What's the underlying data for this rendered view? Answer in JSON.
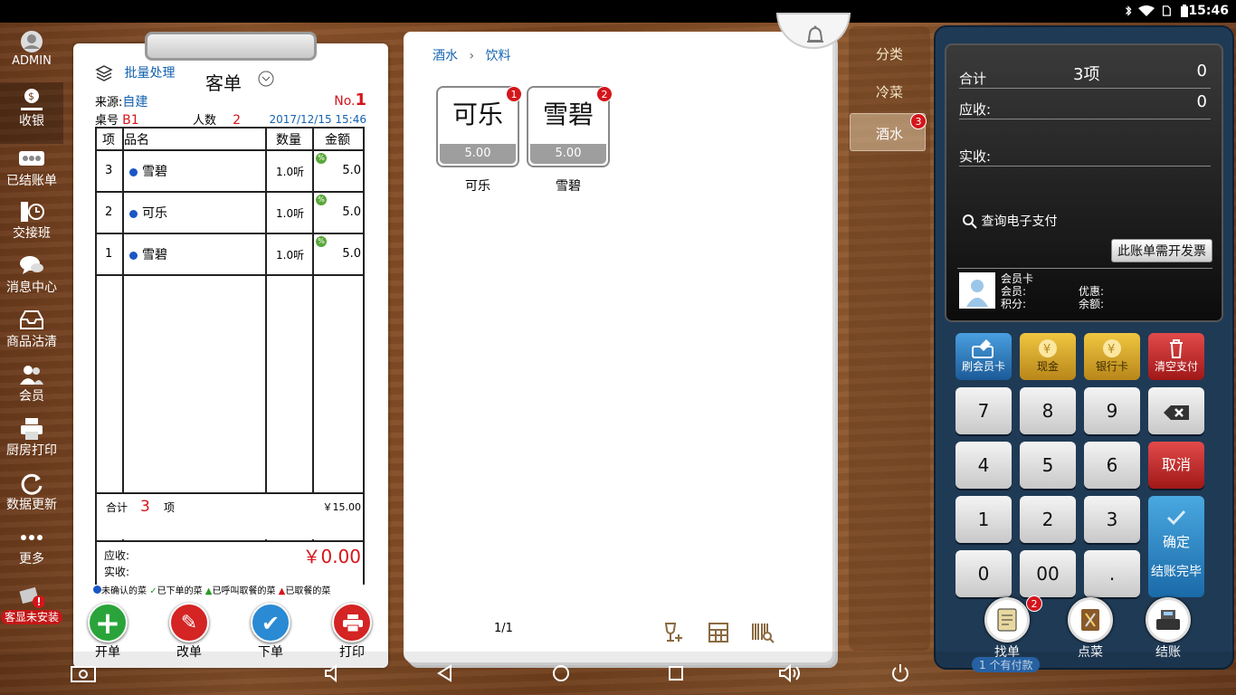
{
  "status": {
    "time": "15:46"
  },
  "sidebar": {
    "user": "ADMIN",
    "items": [
      {
        "label": "收银"
      },
      {
        "label": "已结账单"
      },
      {
        "label": "交接班"
      },
      {
        "label": "消息中心"
      },
      {
        "label": "商品沽清"
      },
      {
        "label": "会员"
      },
      {
        "label": "厨房打印"
      },
      {
        "label": "数据更新"
      },
      {
        "label": "更多"
      }
    ],
    "customer_display": "客显未安装"
  },
  "order": {
    "batch": "批量处理",
    "title": "客单",
    "source_label": "来源:",
    "source": "自建",
    "no_label": "No.",
    "no": "1",
    "table_label": "桌号",
    "table": "B1",
    "people_label": "人数",
    "people": "2",
    "datetime": "2017/12/15 15:46",
    "headers": [
      "项",
      "品名",
      "数量",
      "金额"
    ],
    "rows": [
      {
        "idx": "3",
        "name": "雪碧",
        "qty": "1.0听",
        "amount": "5.0"
      },
      {
        "idx": "2",
        "name": "可乐",
        "qty": "1.0听",
        "amount": "5.0"
      },
      {
        "idx": "1",
        "name": "雪碧",
        "qty": "1.0听",
        "amount": "5.0"
      }
    ],
    "total_label": "合计",
    "total_count": "3",
    "total_unit": "项",
    "total_amount": "￥15.00",
    "receivable_label": "应收:",
    "receivable": "￥0.00",
    "received_label": "实收:",
    "legend": [
      "未确认的菜",
      "已下单的菜",
      "已呼叫取餐的菜",
      "已取餐的菜"
    ],
    "actions": [
      "开单",
      "改单",
      "下单",
      "打印"
    ],
    "legend_colors": {
      "unconfirmed": "#1a56c4",
      "ordered": "#2a9a2a",
      "called": "#2a9a2a",
      "taken": "#d4161c"
    }
  },
  "menu": {
    "crumb1": "酒水",
    "crumb2": "饮料",
    "dishes": [
      {
        "name": "可乐",
        "price": "5.00",
        "badge": "1"
      },
      {
        "name": "雪碧",
        "price": "5.00",
        "badge": "2"
      }
    ],
    "page": "1/1"
  },
  "categories": {
    "items": [
      {
        "label": "分类"
      },
      {
        "label": "冷菜"
      },
      {
        "label": "酒水",
        "badge": "3"
      }
    ]
  },
  "pos": {
    "total_label": "合计",
    "total_count": "3项",
    "total_value": "0",
    "receivable_label": "应收:",
    "receivable_value": "0",
    "received_label": "实收:",
    "query": "查询电子支付",
    "invoice": "此账单需开发票",
    "member_card": "会员卡",
    "member_label": "会员:",
    "points_label": "积分:",
    "discount_label": "优惠:",
    "balance_label": "余额:",
    "funcs": [
      "刷会员卡",
      "现金",
      "银行卡",
      "清空支付"
    ],
    "keys": [
      "7",
      "8",
      "9",
      "4",
      "5",
      "6",
      "1",
      "2",
      "3",
      "0",
      "00",
      "."
    ],
    "cancel": "取消",
    "confirm": "确定",
    "confirm_sub": "结账完毕",
    "bottom": [
      {
        "label": "找单",
        "badge": "2"
      },
      {
        "label": "点菜"
      },
      {
        "label": "结账"
      }
    ],
    "pay_note": "1 个有付款"
  }
}
